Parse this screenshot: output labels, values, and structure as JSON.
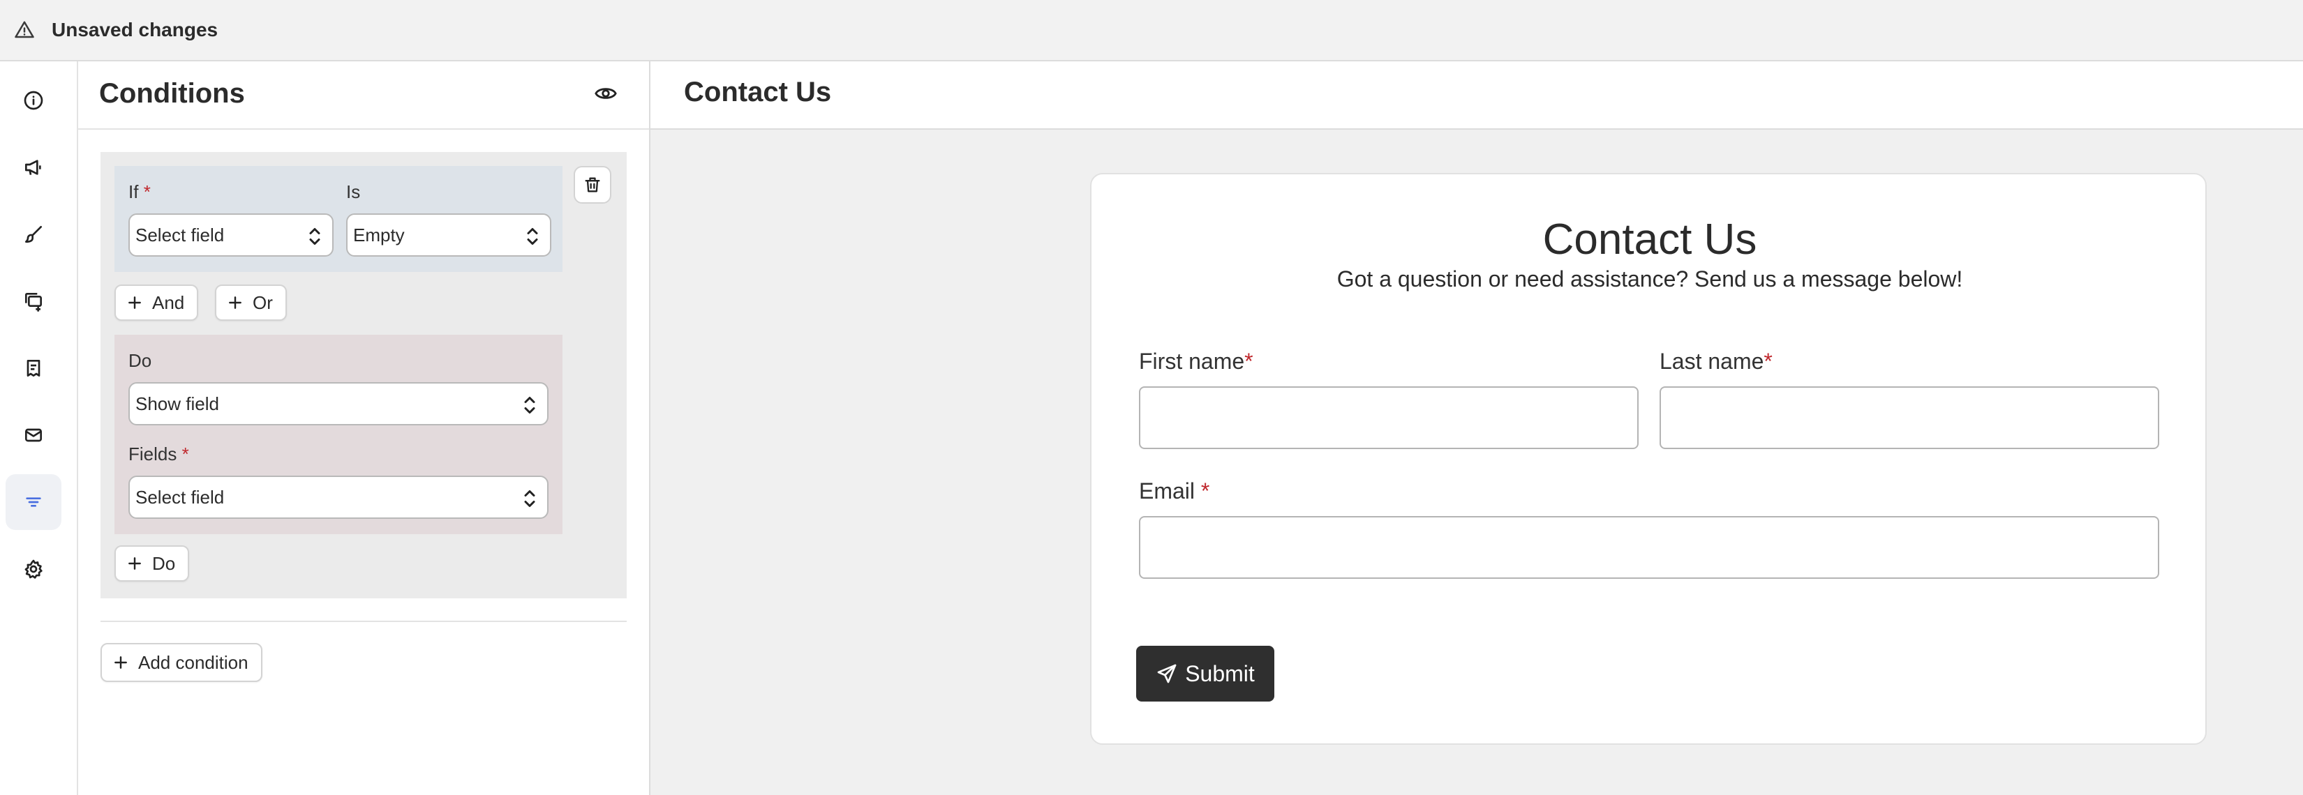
{
  "topbar": {
    "title": "Unsaved changes",
    "icon": "warning-triangle-icon"
  },
  "rail": {
    "items": [
      {
        "icon": "info-icon",
        "active": false
      },
      {
        "icon": "megaphone-icon",
        "active": false
      },
      {
        "icon": "paintbrush-icon",
        "active": false
      },
      {
        "icon": "stacked-cards-add-icon",
        "active": false
      },
      {
        "icon": "receipt-icon",
        "active": false
      },
      {
        "icon": "mail-icon",
        "active": false
      },
      {
        "icon": "filter-lines-icon",
        "active": true
      },
      {
        "icon": "gear-icon",
        "active": false
      }
    ],
    "active_color": "#4a6fe0"
  },
  "conditions": {
    "title": "Conditions",
    "if_label": "If",
    "is_label": "Is",
    "if_field_value": "Select field",
    "is_value": "Empty",
    "and_label": "And",
    "or_label": "Or",
    "do_label": "Do",
    "do_value": "Show field",
    "fields_label": "Fields",
    "fields_value": "Select field",
    "add_do_label": "Do",
    "add_condition_label": "Add condition",
    "required_mark": "*"
  },
  "preview": {
    "header_title": "Contact Us",
    "form_title": "Contact Us",
    "form_subtitle": "Got a question or need assistance? Send us a message below!",
    "first_name_label": "First name",
    "last_name_label": "Last name",
    "email_label": "Email",
    "submit_label": "Submit",
    "required_mark": "*"
  },
  "colors": {
    "required": "#c0282d",
    "submit_bg": "#2f2f2f",
    "if_box_bg": "#dde3e9",
    "do_box_bg": "#e3dadc"
  }
}
